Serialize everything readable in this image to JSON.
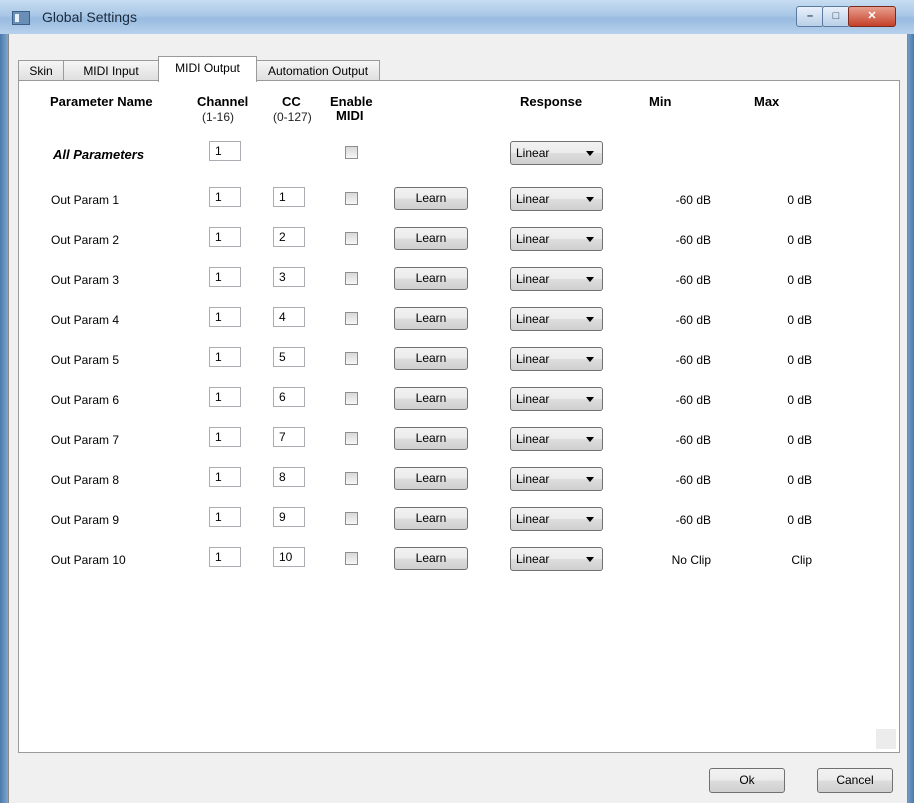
{
  "window": {
    "title": "Global Settings"
  },
  "tabs": [
    "Skin",
    "MIDI Input",
    "MIDI Output",
    "Automation Output"
  ],
  "active_tab": "MIDI Output",
  "headers": {
    "param_name": "Parameter Name",
    "channel": "Channel",
    "channel_range": "(1-16)",
    "cc": "CC",
    "cc_range": "(0-127)",
    "enable_1": "Enable",
    "enable_2": "MIDI",
    "response": "Response",
    "min": "Min",
    "max": "Max"
  },
  "all_params": {
    "label": "All Parameters",
    "channel": "1",
    "response": "Linear"
  },
  "rows": [
    {
      "name": "Out Param 1",
      "channel": "1",
      "cc": "1",
      "learn": "Learn",
      "response": "Linear",
      "min": "-60 dB",
      "max": "0 dB"
    },
    {
      "name": "Out Param 2",
      "channel": "1",
      "cc": "2",
      "learn": "Learn",
      "response": "Linear",
      "min": "-60 dB",
      "max": "0 dB"
    },
    {
      "name": "Out Param 3",
      "channel": "1",
      "cc": "3",
      "learn": "Learn",
      "response": "Linear",
      "min": "-60 dB",
      "max": "0 dB"
    },
    {
      "name": "Out Param 4",
      "channel": "1",
      "cc": "4",
      "learn": "Learn",
      "response": "Linear",
      "min": "-60 dB",
      "max": "0 dB"
    },
    {
      "name": "Out Param 5",
      "channel": "1",
      "cc": "5",
      "learn": "Learn",
      "response": "Linear",
      "min": "-60 dB",
      "max": "0 dB"
    },
    {
      "name": "Out Param 6",
      "channel": "1",
      "cc": "6",
      "learn": "Learn",
      "response": "Linear",
      "min": "-60 dB",
      "max": "0 dB"
    },
    {
      "name": "Out Param 7",
      "channel": "1",
      "cc": "7",
      "learn": "Learn",
      "response": "Linear",
      "min": "-60 dB",
      "max": "0 dB"
    },
    {
      "name": "Out Param 8",
      "channel": "1",
      "cc": "8",
      "learn": "Learn",
      "response": "Linear",
      "min": "-60 dB",
      "max": "0 dB"
    },
    {
      "name": "Out Param 9",
      "channel": "1",
      "cc": "9",
      "learn": "Learn",
      "response": "Linear",
      "min": "-60 dB",
      "max": "0 dB"
    },
    {
      "name": "Out Param 10",
      "channel": "1",
      "cc": "10",
      "learn": "Learn",
      "response": "Linear",
      "min": "No Clip",
      "max": "Clip"
    }
  ],
  "footer": {
    "ok": "Ok",
    "cancel": "Cancel"
  }
}
